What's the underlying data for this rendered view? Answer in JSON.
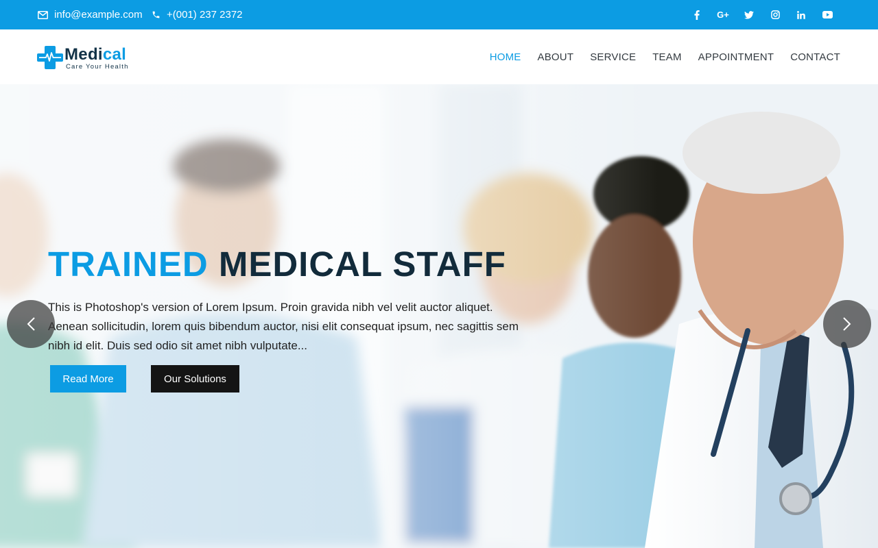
{
  "topbar": {
    "email": "info@example.com",
    "phone": "+(001) 237 2372",
    "social": [
      "facebook-icon",
      "google-plus-icon",
      "twitter-icon",
      "instagram-icon",
      "linkedin-icon",
      "youtube-icon"
    ],
    "social_labels": {
      "google_plus": "G+"
    }
  },
  "logo": {
    "brand_main": "Medi",
    "brand_accent": "cal",
    "tagline": "Care Your Health"
  },
  "nav": {
    "items": [
      "HOME",
      "ABOUT",
      "SERVICE",
      "TEAM",
      "APPOINTMENT",
      "CONTACT"
    ],
    "active": "HOME"
  },
  "hero": {
    "title_accent": "TRAINED",
    "title_rest": "MEDICAL STAFF",
    "text": "This is Photoshop's version of Lorem Ipsum. Proin gravida nibh vel velit auctor aliquet. Aenean sollicitudin, lorem quis bibendum auctor, nisi elit consequat ipsum, nec sagittis sem nibh id elit. Duis sed odio sit amet nibh vulputate...",
    "btn_read_more": "Read More",
    "btn_solutions": "Our Solutions"
  },
  "colors": {
    "accent": "#0c9ce3",
    "dark": "#122b3b",
    "button_dark": "#141414"
  }
}
